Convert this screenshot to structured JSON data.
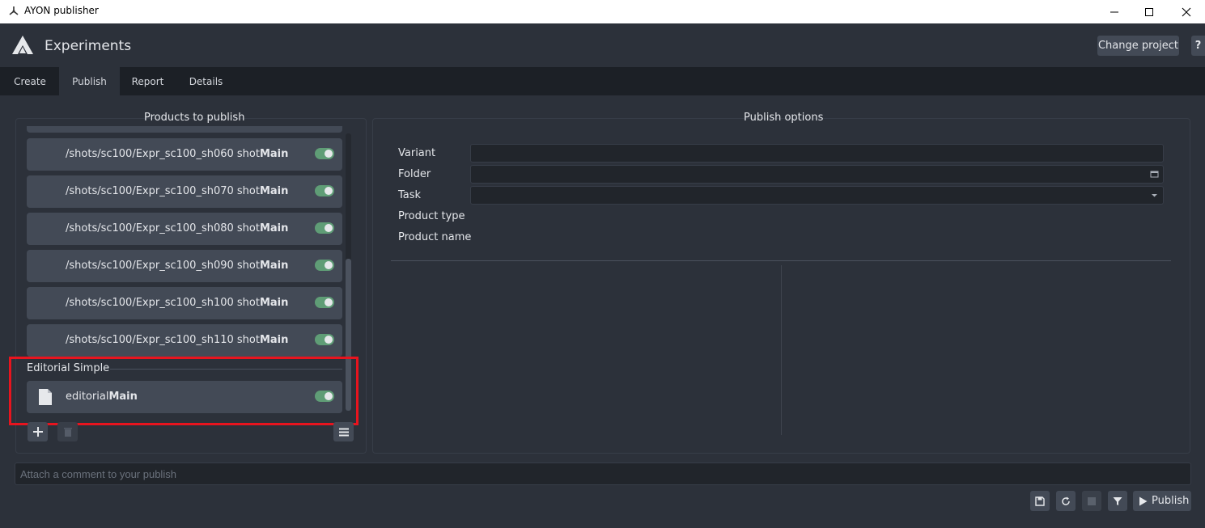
{
  "window": {
    "title": "AYON publisher"
  },
  "header": {
    "project_name": "Experiments",
    "change_project_label": "Change project",
    "help_label": "?"
  },
  "tabs": [
    {
      "label": "Create",
      "active": false
    },
    {
      "label": "Publish",
      "active": true
    },
    {
      "label": "Report",
      "active": false
    },
    {
      "label": "Details",
      "active": false
    }
  ],
  "products_panel": {
    "title": "Products to publish",
    "items": [
      {
        "prefix": "/shots/sc100/Expr_sc100_sh060 shot",
        "bold": "Main",
        "enabled": true
      },
      {
        "prefix": "/shots/sc100/Expr_sc100_sh070 shot",
        "bold": "Main",
        "enabled": true
      },
      {
        "prefix": "/shots/sc100/Expr_sc100_sh080 shot",
        "bold": "Main",
        "enabled": true
      },
      {
        "prefix": "/shots/sc100/Expr_sc100_sh090 shot",
        "bold": "Main",
        "enabled": true
      },
      {
        "prefix": "/shots/sc100/Expr_sc100_sh100 shot",
        "bold": "Main",
        "enabled": true
      },
      {
        "prefix": "/shots/sc100/Expr_sc100_sh110 shot",
        "bold": "Main",
        "enabled": true
      }
    ],
    "group": {
      "label": "Editorial Simple",
      "items": [
        {
          "prefix": "editorial",
          "bold": "Main",
          "enabled": true,
          "icon": "file-icon"
        }
      ]
    }
  },
  "publish_options": {
    "title": "Publish options",
    "fields": [
      {
        "label": "Variant",
        "value": ""
      },
      {
        "label": "Folder",
        "value": ""
      },
      {
        "label": "Task",
        "value": ""
      },
      {
        "label": "Product type",
        "value": ""
      },
      {
        "label": "Product name",
        "value": ""
      }
    ]
  },
  "comment": {
    "placeholder": "Attach a comment to your publish"
  },
  "actions": {
    "publish_label": "Publish"
  },
  "colors": {
    "toggle_on": "#5f9d76",
    "highlight": "#e8141e",
    "background": "#2c313a"
  }
}
